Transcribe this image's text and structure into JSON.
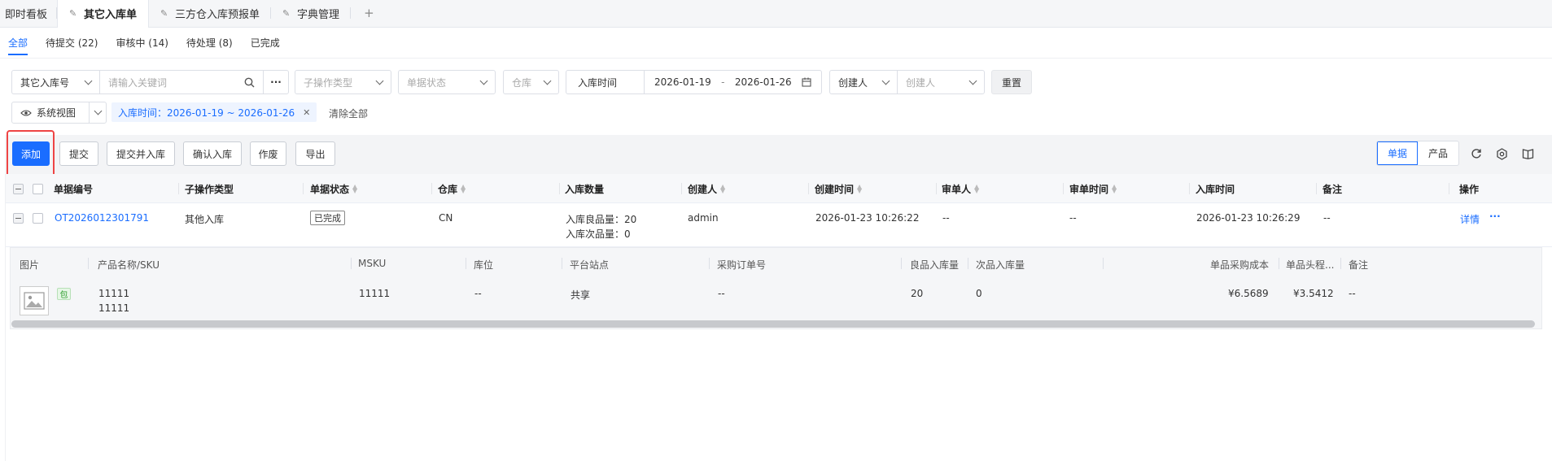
{
  "top_tabs": [
    {
      "label": "即时看板"
    },
    {
      "label": "其它入库单"
    },
    {
      "label": "三方仓入库预报单"
    },
    {
      "label": "字典管理"
    },
    {
      "label": "+"
    }
  ],
  "status_tabs": [
    {
      "label": "全部"
    },
    {
      "label": "待提交 (22)"
    },
    {
      "label": "审核中 (14)"
    },
    {
      "label": "待处理 (8)"
    },
    {
      "label": "已完成"
    }
  ],
  "filters": {
    "search_type": "其它入库号",
    "search_placeholder": "请输入关键词",
    "more": "···",
    "sub_op_type": "子操作类型",
    "doc_status": "单据状态",
    "warehouse": "仓库",
    "date_field": "入库时间",
    "date_from": "2026-01-19",
    "date_sep": "-",
    "date_to": "2026-01-26",
    "creator_field": "创建人",
    "creator_placeholder": "创建人",
    "reset": "重置",
    "view": "系统视图",
    "active_filter": "入库时间：2026-01-19 ~ 2026-01-26",
    "clear_all": "清除全部"
  },
  "toolbar": {
    "add": "添加",
    "submit": "提交",
    "submit_inbound": "提交并入库",
    "confirm_inbound": "确认入库",
    "void": "作废",
    "export": "导出",
    "view_doc": "单据",
    "view_product": "产品"
  },
  "table": {
    "headers": {
      "doc_no": "单据编号",
      "sub_type": "子操作类型",
      "status": "单据状态",
      "warehouse": "仓库",
      "inbound_qty": "入库数量",
      "creator": "创建人",
      "create_time": "创建时间",
      "reviewer": "审单人",
      "review_time": "审单时间",
      "inbound_time": "入库时间",
      "remark": "备注",
      "action": "操作"
    },
    "rows": [
      {
        "doc_no": "OT2026012301791",
        "sub_type": "其他入库",
        "status": "已完成",
        "warehouse": "CN",
        "good_qty": "入库良品量：20",
        "bad_qty": "入库次品量：0",
        "creator": "admin",
        "create_time": "2026-01-23 10:26:22",
        "reviewer": "--",
        "review_time": "--",
        "inbound_time": "2026-01-23 10:26:29",
        "remark": "--",
        "detail": "详情",
        "more": "···"
      }
    ]
  },
  "sub_table": {
    "headers": {
      "image": "图片",
      "product": "产品名称/SKU",
      "msku": "MSKU",
      "location": "库位",
      "platform": "平台站点",
      "po_no": "采购订单号",
      "good_in": "良品入库量",
      "bad_in": "次品入库量",
      "unit_cost": "单品采购成本",
      "unit_freight": "单品头程...",
      "remark": "备注"
    },
    "rows": [
      {
        "tag": "包",
        "name": "11111",
        "sku": "11111",
        "msku": "11111",
        "location": "--",
        "platform": "共享",
        "po_no": "--",
        "good_in": "20",
        "bad_in": "0",
        "unit_cost": "¥6.5689",
        "unit_freight": "¥3.5412",
        "remark": "--"
      }
    ]
  },
  "colors": {
    "primary": "#1a6dff",
    "highlight": "#ee4444"
  }
}
